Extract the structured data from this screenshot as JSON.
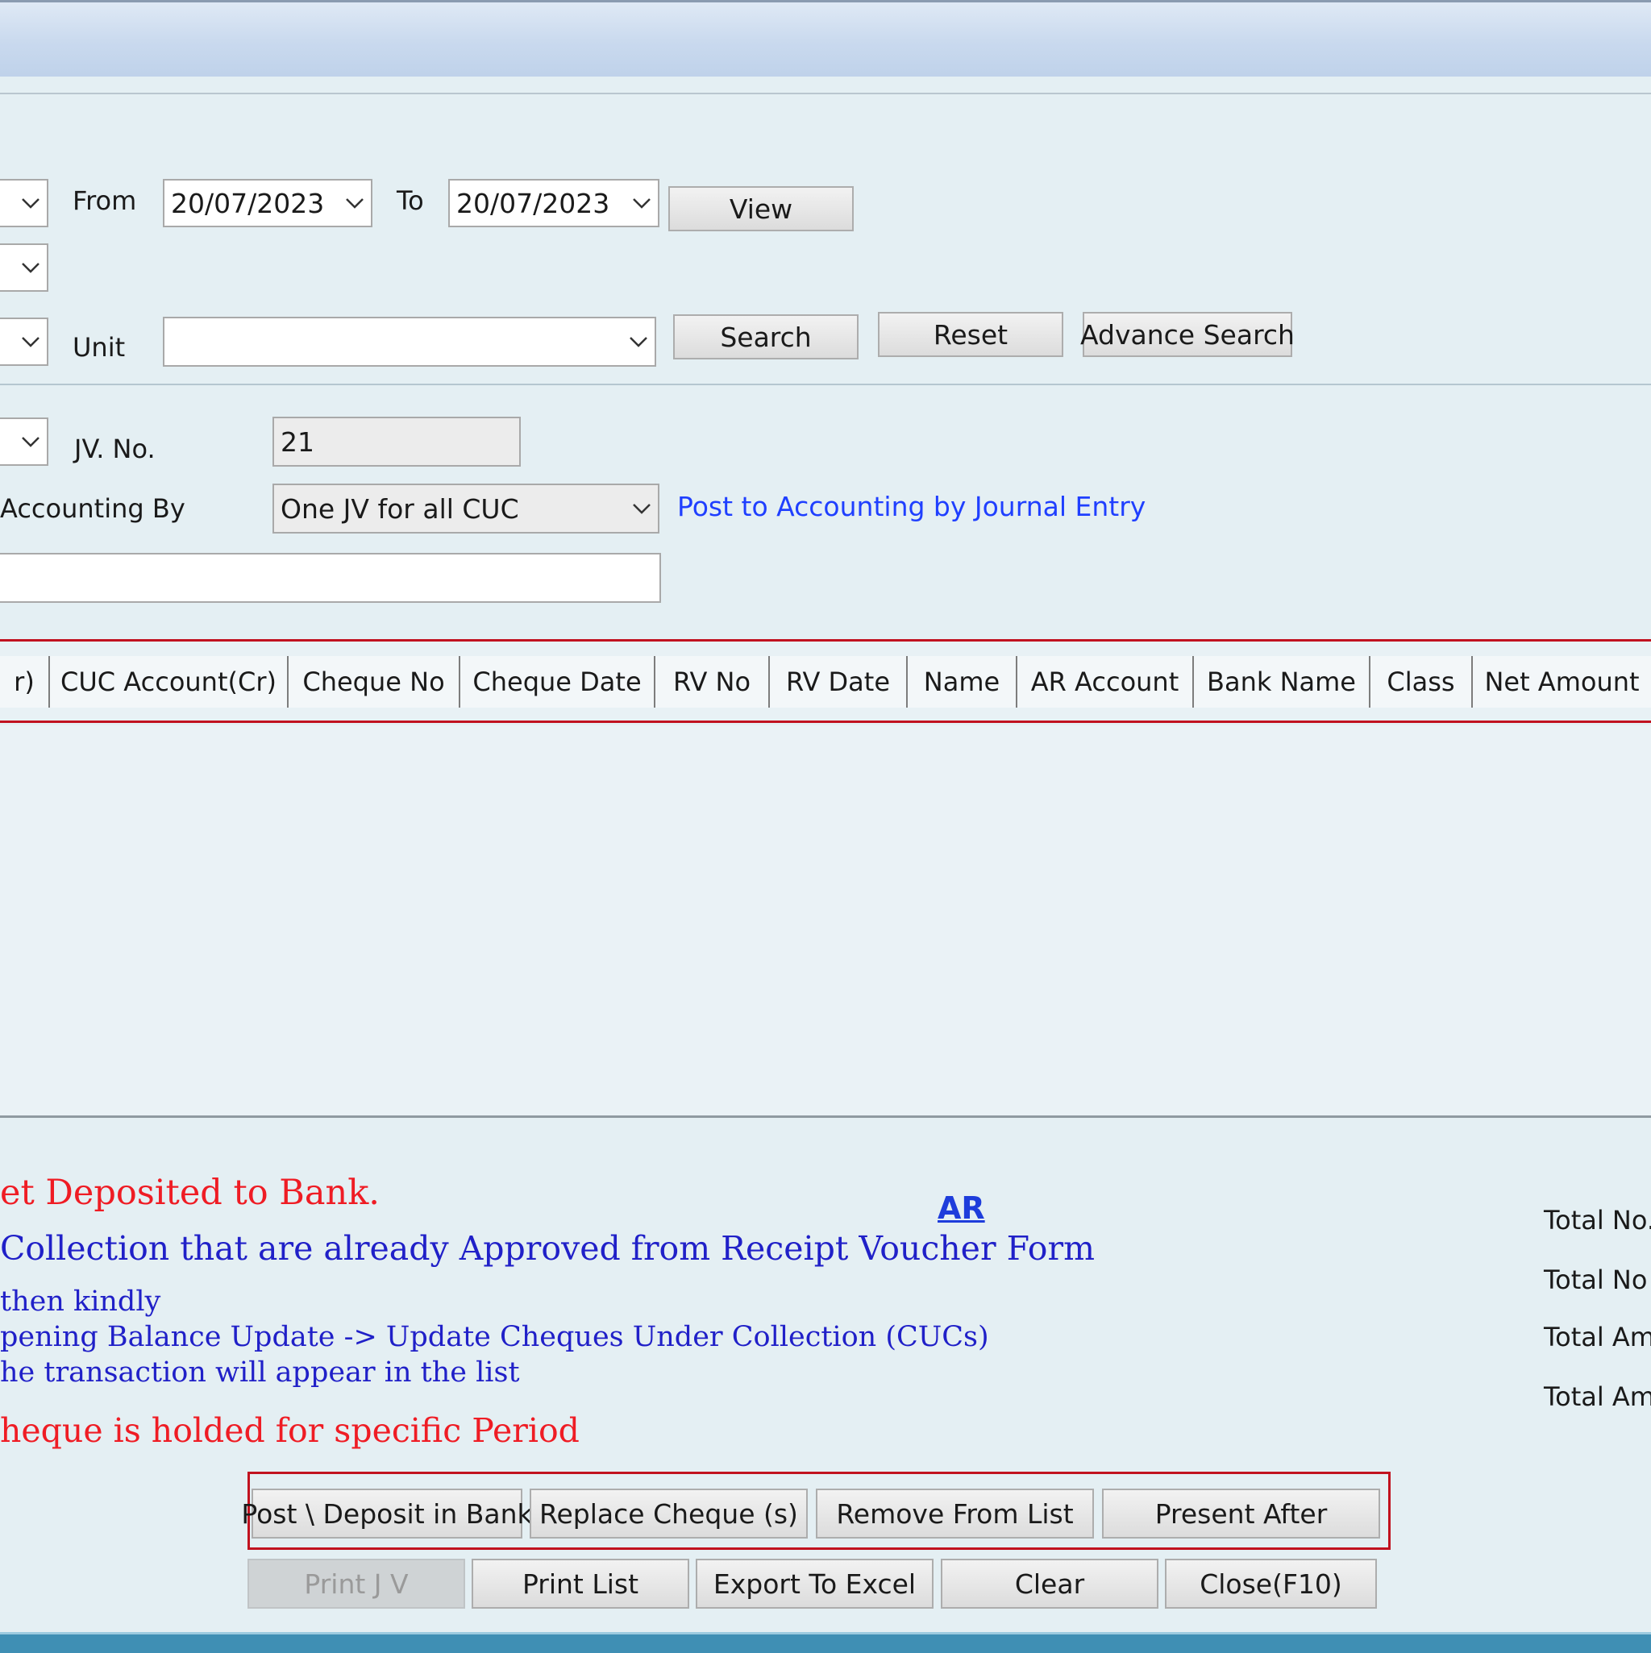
{
  "filters": {
    "from_label": "From",
    "from_date": "20/07/2023",
    "to_label": "To",
    "to_date": "20/07/2023",
    "view_button": "View",
    "unit_label": "Unit",
    "unit_value": "",
    "search_button": "Search",
    "reset_button": "Reset",
    "advance_search_button": "Advance Search"
  },
  "posting": {
    "jv_label": "JV. No.",
    "jv_value": "21",
    "accounting_by_label": "Accounting By",
    "accounting_by_value": "One JV for all CUC",
    "journal_entry_link": "Post to Accounting by Journal Entry",
    "remarks_value": ""
  },
  "grid": {
    "columns": [
      "r)",
      "CUC Account(Cr)",
      "Cheque No",
      "Cheque Date",
      "RV No",
      "RV Date",
      "Name",
      "AR Account",
      "Bank Name",
      "Class",
      "Net Amount"
    ],
    "rows": []
  },
  "notes": {
    "line1": "et Deposited to Bank.",
    "line2": "Collection that are already Approved from Receipt Voucher Form",
    "line3": "then kindly",
    "line4": "pening Balance Update -> Update Cheques Under Collection (CUCs)",
    "line5": "he transaction will appear in the list",
    "line6": "heque is holded for specific Period",
    "ar_link": "AR"
  },
  "totals": {
    "t1": "Total No.",
    "t2": "Total No c",
    "t3": "Total Amo",
    "t4": "Total Amo"
  },
  "actions": {
    "post_deposit": "Post \\ Deposit in Bank",
    "replace_cheque": "Replace Cheque (s)",
    "remove_from_list": "Remove From List",
    "present_after": "Present After",
    "print_jv": "Print J V",
    "print_list": "Print List",
    "export_excel": "Export To Excel",
    "clear": "Clear",
    "close": "Close(F10)"
  },
  "colors": {
    "highlight_red": "#c1121f",
    "note_red": "#ef1c24",
    "note_blue": "#2020c8",
    "link_blue": "#1f3fff"
  }
}
